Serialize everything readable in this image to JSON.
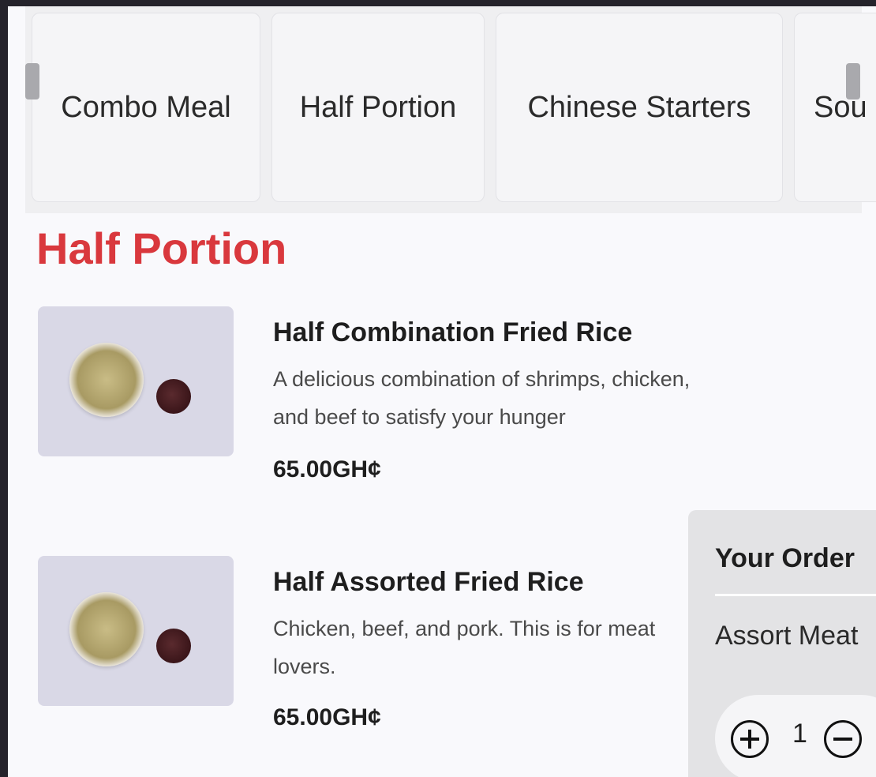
{
  "categories": {
    "tabs": [
      {
        "label": "Combo Meal"
      },
      {
        "label": "Half Portion"
      },
      {
        "label": "Chinese Starters"
      },
      {
        "label": "Sou"
      }
    ]
  },
  "section": {
    "title": "Half Portion"
  },
  "items": [
    {
      "name": "Half Combination Fried Rice",
      "description": "A delicious combination of shrimps, chicken, and beef to satisfy your hunger",
      "price": "65.00GH¢"
    },
    {
      "name": "Half Assorted Fried Rice",
      "description": "Chicken, beef, and pork. This is for meat lovers.",
      "price": "65.00GH¢"
    }
  ],
  "order": {
    "title": "Your Order",
    "line_item": "Assort Meat",
    "quantity": "1"
  },
  "colors": {
    "accent": "#d9383d",
    "background": "#f9f9fc",
    "frame": "#25232b"
  },
  "icons": {
    "plus": "plus-circle-icon",
    "minus": "minus-circle-icon",
    "scroll_left": "scroll-left-icon",
    "scroll_right": "scroll-right-icon"
  }
}
